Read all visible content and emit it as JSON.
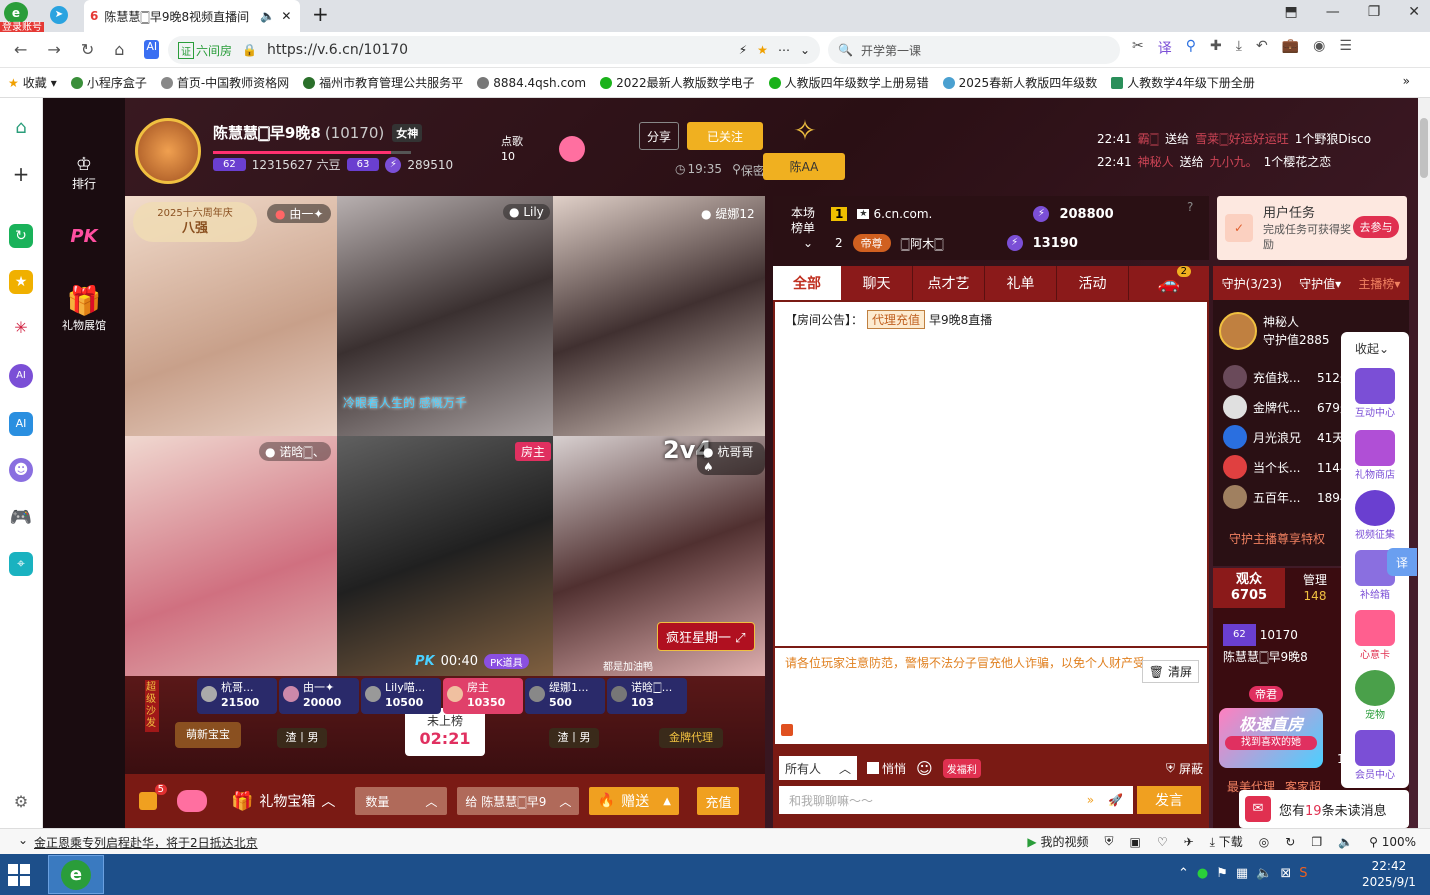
{
  "browser": {
    "login_badge": "登录账号",
    "tab_title": "陈慧慧🀆早9晚8视频直播间",
    "url_label": "六间房",
    "url": "https://v.6.cn/10170",
    "search_text": "开学第一课",
    "bookmarks": [
      "收藏",
      "小程序盒子",
      "首页-中国教师资格网",
      "福州市教育管理公共服务平",
      "8884.4qsh.com",
      "2022最新人教版数学电子",
      "人教版四年级数学上册易错",
      "2025春新人教版四年级数",
      "人教数学4年级下册全册"
    ]
  },
  "leftbar": {
    "rank_label": "排行",
    "pk_label": "PK",
    "gift_label": "礼物展馆"
  },
  "host": {
    "name": "陈慧慧🀆早9晚8",
    "room_id": "(10170)",
    "tag": "女神",
    "level_left": "62",
    "beans": "12315627 六豆",
    "level_right": "63",
    "points": "289510",
    "song_label": "点歌",
    "song_count": "10",
    "share": "分享",
    "followed": "已关注",
    "time": "19:35",
    "secure": "保密",
    "chen_aa": "陈AA"
  },
  "feed": [
    {
      "time": "22:41",
      "user": "霸🀆",
      "action": "送给",
      "to": "雪莱🀆好运好运旺",
      "gift": "1个野狼Disco"
    },
    {
      "time": "22:41",
      "user": "神秘人",
      "action": "送给",
      "to": "九小九。",
      "gift": "1个樱花之恋"
    }
  ],
  "video": {
    "anniv_top": "2025十六周年庆",
    "anniv_bottom": "八强",
    "cells": [
      {
        "name": "由一✦",
        "caption": ""
      },
      {
        "name": "Lily",
        "caption": "冷眼看人生的 感慨万千"
      },
      {
        "name": "缇娜12",
        "caption": ""
      },
      {
        "name": "诺晗🀆、",
        "caption": ""
      },
      {
        "name": "房主",
        "caption": ""
      },
      {
        "name": "杭哥哥♠",
        "caption": ""
      }
    ],
    "pk_score": "2v4",
    "crazy": "疯狂星期一",
    "pk_time": "00:40",
    "pk_badge": "PK道具",
    "scroll_text": "都是加油鸭",
    "super_sofa": "超级沙发",
    "seats": [
      {
        "name": "杭哥...",
        "score": "21500"
      },
      {
        "name": "由一✦",
        "score": "20000"
      },
      {
        "name": "Lily喵...",
        "score": "10500"
      },
      {
        "name": "房主",
        "score": "10350"
      },
      {
        "name": "缇娜1...",
        "score": "500"
      },
      {
        "name": "诺晗🀆...",
        "score": "103"
      }
    ],
    "fans": [
      "萌新宝宝",
      "渣丨男",
      "渣丨男",
      "金牌代理"
    ],
    "not_listed": "未上榜",
    "countdown": "02:21"
  },
  "bottom_bar": {
    "badge": "5",
    "treasure": "礼物宝箱",
    "qty": "数量",
    "give_to": "给 陈慧慧🀆早9",
    "send": "赠送",
    "recharge": "充值"
  },
  "rank": {
    "label": "本场榜单",
    "rows": [
      {
        "pos": "1",
        "name": "6.cn.com.",
        "value": "208800"
      },
      {
        "pos": "2",
        "name": "🀆阿木🀆",
        "value": "13190",
        "title": "帝尊"
      }
    ]
  },
  "chat": {
    "tabs": [
      "全部",
      "聊天",
      "点才艺",
      "礼单",
      "活动"
    ],
    "car_badge": "2",
    "notice_prefix": "【房间公告】：",
    "notice_tag": "代理充值",
    "notice_text": "早9晚8直播",
    "warning": "请各位玩家注意防范，警惕不法分子冒充他人诈骗，以免个人财产受到损失",
    "clear": "清屏",
    "target": "所有人",
    "whisper": "悄悄",
    "red_packet": "发福利",
    "shield": "屏蔽",
    "input_placeholder": "和我聊聊嘛～～",
    "send": "发言"
  },
  "task": {
    "title": "用户任务",
    "desc": "完成任务可获得奖励",
    "join": "去参与"
  },
  "guard": {
    "tab1": "守护(3/23)",
    "tab2": "守护值",
    "tab3": "主播榜",
    "top_name": "神秘人",
    "top_value": "守护值2885",
    "list": [
      {
        "name": "充值找...",
        "value": "512天"
      },
      {
        "name": "金牌代...",
        "value": "679天"
      },
      {
        "name": "月光浪兄",
        "value": "41天"
      },
      {
        "name": "当个长...",
        "value": "1144天"
      },
      {
        "name": "五百年...",
        "value": "1894天"
      }
    ],
    "privilege": "守护主播尊享特权",
    "audience_label": "观众",
    "audience": "6705",
    "admin_label": "管理",
    "admin": "148",
    "host_id": "10170",
    "host_name": "陈慧慧🀆早9晚8",
    "promo_title": "极速直房",
    "promo_sub": "找到喜欢的她",
    "promo_num": "111",
    "promo_bottom": "最美代理",
    "promo_bottom2": "客家超",
    "emperor": "帝君"
  },
  "side_tools": {
    "collapse": "收起",
    "items": [
      "互动中心",
      "礼物商店",
      "视频征集",
      "补给箱",
      "心意卡",
      "宠物",
      "会员中心"
    ],
    "translate": "译"
  },
  "unread": {
    "prefix": "您有",
    "count": "19",
    "suffix": "条未读消息"
  },
  "status": {
    "news": "金正恩乘专列启程赴华，将于2日抵达北京",
    "my_video": "我的视频",
    "download": "下载",
    "zoom": "100%"
  },
  "taskbar": {
    "time": "22:42",
    "date": "2025/9/1"
  }
}
